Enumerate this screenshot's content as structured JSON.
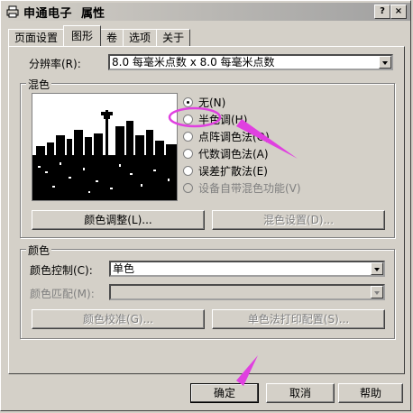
{
  "title": {
    "app": "申通电子",
    "suffix": "属性",
    "help": "?",
    "close": "×"
  },
  "tabs": [
    "页面设置",
    "图形",
    "卷",
    "选项",
    "关于"
  ],
  "resolution": {
    "label": "分辨率(R):",
    "value": "8.0 每毫米点数 x 8.0 每毫米点数"
  },
  "dither": {
    "group_title": "混色",
    "options": [
      {
        "label": "无(N)",
        "selected": true,
        "enabled": true
      },
      {
        "label": "半色调(H)",
        "selected": false,
        "enabled": true
      },
      {
        "label": "点阵调色法(O)",
        "selected": false,
        "enabled": true
      },
      {
        "label": "代数调色法(A)",
        "selected": false,
        "enabled": true
      },
      {
        "label": "误差扩散法(E)",
        "selected": false,
        "enabled": true
      },
      {
        "label": "设备自带混色功能(V)",
        "selected": false,
        "enabled": false
      }
    ],
    "color_adjust": "颜色调整(L)...",
    "dither_settings": "混色设置(D)..."
  },
  "color": {
    "group_title": "颜色",
    "control_label": "颜色控制(C):",
    "control_value": "单色",
    "match_label": "颜色匹配(M):",
    "match_value": "",
    "calibrate": "颜色校准(G)...",
    "mono_print": "单色法打印配置(S)..."
  },
  "footer": {
    "ok": "确定",
    "cancel": "取消",
    "help": "帮助"
  },
  "colors": {
    "annotation": "#e040e0",
    "face": "#d4d0c8"
  }
}
